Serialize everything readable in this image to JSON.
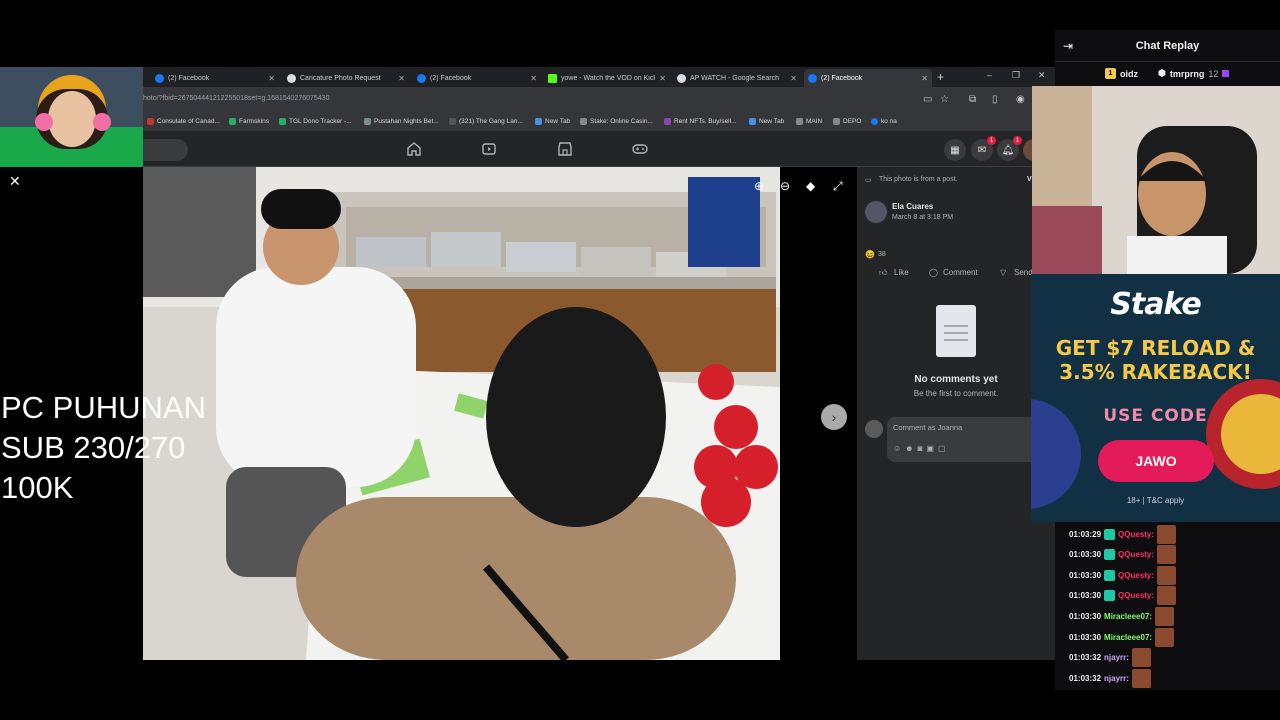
{
  "browser": {
    "tabs": [
      {
        "label": "(2) Facebook",
        "color": "#1877f2"
      },
      {
        "label": "Caricature Photo Request",
        "color": "#dadce0"
      },
      {
        "label": "(2) Facebook",
        "color": "#1877f2"
      },
      {
        "label": "yowe - Watch the VOD on Kick",
        "color": "#53fc18"
      },
      {
        "label": "AP WATCH - Google Search",
        "color": "#dadce0"
      },
      {
        "label": "(2) Facebook",
        "color": "#1877f2"
      }
    ],
    "url": "hoto/?fbid=267504441212255018set=g.1681540276075430",
    "bookmarks": [
      "Consulate of Canad...",
      "Farmskins",
      "TGL Dono Tracker -...",
      "Pustahan Nights Bet...",
      "(321) The Gang Lan...",
      "New Tab",
      "Stake: Online Casin...",
      "Rent NFTs. Buy/sell...",
      "New Tab",
      "MAIN",
      "DEPO",
      "ko na"
    ],
    "notification_badge": "1"
  },
  "post": {
    "from_post_text": "This photo is from a post.",
    "view_link": "View",
    "author": "Ela Cuares",
    "date": "March 8 at 3:18 PM",
    "reaction_count": "38",
    "like_label": "Like",
    "comment_label": "Comment",
    "send_label": "Send",
    "no_comments": "No comments yet",
    "be_first": "Be the first to comment.",
    "comment_placeholder": "Comment as Joanna"
  },
  "stream_overlay": {
    "line1": "PC PUHUNAN",
    "line2": "SUB 230/270",
    "line3": "100K"
  },
  "chat": {
    "title": "Chat Replay",
    "gifters": [
      {
        "rank": "1",
        "name": "oidz"
      },
      {
        "name": "tmrprng",
        "count": "12"
      }
    ],
    "messages": [
      {
        "time": "01:03:29",
        "user": "QQuesty:",
        "color": "#ff2e63"
      },
      {
        "time": "01:03:30",
        "user": "QQuesty:",
        "color": "#ff2e63"
      },
      {
        "time": "01:03:30",
        "user": "QQuesty:",
        "color": "#ff2e63"
      },
      {
        "time": "01:03:30",
        "user": "QQuesty:",
        "color": "#ff2e63"
      },
      {
        "time": "01:03:30",
        "user": "Miracleee07:",
        "color": "#7cff6b"
      },
      {
        "time": "01:03:30",
        "user": "Miracleee07:",
        "color": "#7cff6b"
      },
      {
        "time": "01:03:32",
        "user": "njayrr:",
        "color": "#c9a7ff"
      },
      {
        "time": "01:03:32",
        "user": "njayrr:",
        "color": "#c9a7ff"
      }
    ]
  },
  "ad": {
    "logo": "Stake",
    "headline_line1": "GET $7 RELOAD &",
    "headline_line2": "3.5% RAKEBACK!",
    "code_label": "USE CODE",
    "code": "JAWO",
    "legal": "18+ | T&C apply"
  }
}
